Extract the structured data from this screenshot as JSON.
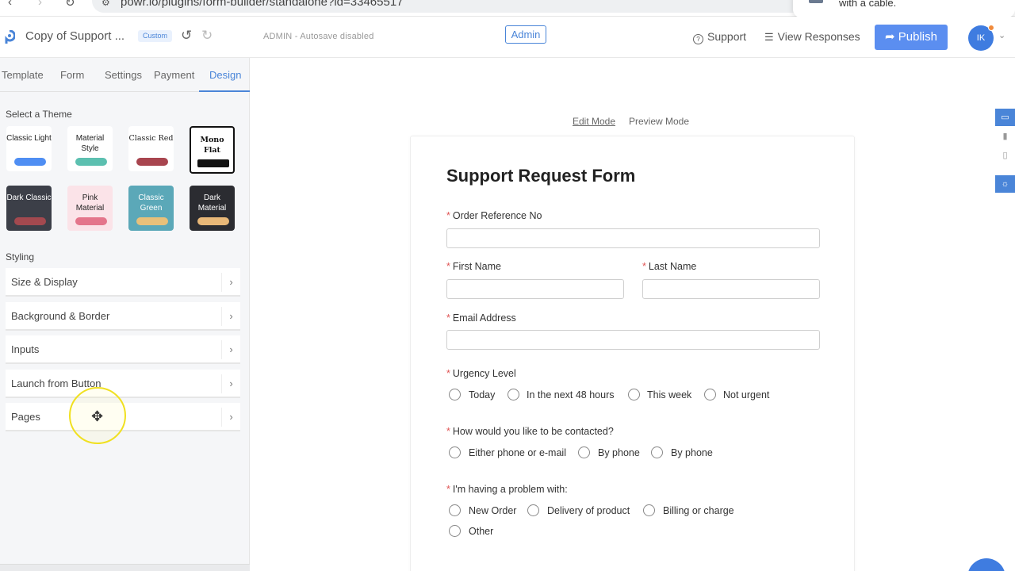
{
  "browser": {
    "url": "powr.io/plugins/form-builder/standalone?id=33465517",
    "notification": "with a cable."
  },
  "header": {
    "doc_title": "Copy of Support ...",
    "badge": "Custom",
    "autosave": "ADMIN - Autosave disabled",
    "admin_label": "Admin",
    "support_label": "Support",
    "view_responses_label": "View Responses",
    "publish_label": "Publish",
    "avatar_initials": "IK"
  },
  "sidebar": {
    "tabs": [
      "Template",
      "Form",
      "Settings",
      "Payment",
      "Design"
    ],
    "active_tab": "Design",
    "theme_heading": "Select a Theme",
    "themes": [
      {
        "name": "Classic Light",
        "bg": "#ffffff",
        "fg": "#222222",
        "swatch": "#4f8ef3"
      },
      {
        "name": "Material Style",
        "bg": "#ffffff",
        "fg": "#222222",
        "swatch": "#5cc0b0"
      },
      {
        "name": "Classic Red",
        "bg": "#ffffff",
        "fg": "#222222",
        "swatch": "#a8454f"
      },
      {
        "name": "Mono Flat",
        "bg": "#ffffff",
        "fg": "#111111",
        "swatch": "#111111"
      },
      {
        "name": "Dark Classic",
        "bg": "#3c3f48",
        "fg": "#ffffff",
        "swatch": "#a3494f"
      },
      {
        "name": "Pink Material",
        "bg": "#fbe3e8",
        "fg": "#222222",
        "swatch": "#e4758b"
      },
      {
        "name": "Classic Green",
        "bg": "#5ba8b8",
        "fg": "#ffffff",
        "swatch": "#e8c07a"
      },
      {
        "name": "Dark Material",
        "bg": "#2b2c31",
        "fg": "#ffffff",
        "swatch": "#e8b878"
      }
    ],
    "styling_heading": "Styling",
    "styling_items": [
      "Size & Display",
      "Background & Border",
      "Inputs",
      "Launch from Button",
      "Pages"
    ]
  },
  "canvas": {
    "edit_mode": "Edit Mode",
    "preview_mode": "Preview Mode",
    "form": {
      "title": "Support Request Form",
      "order_ref": "Order Reference No",
      "first_name": "First Name",
      "last_name": "Last Name",
      "email": "Email Address",
      "urgency": {
        "label": "Urgency Level",
        "options": [
          "Today",
          "In the next 48 hours",
          "This week",
          "Not urgent"
        ]
      },
      "contact": {
        "label": "How would you like to be contacted?",
        "options": [
          "Either phone or e-mail",
          "By phone",
          "By phone"
        ]
      },
      "problem": {
        "label": "I'm having a problem with:",
        "options": [
          "New Order",
          "Delivery of product",
          "Billing or charge",
          "Other"
        ]
      }
    }
  }
}
